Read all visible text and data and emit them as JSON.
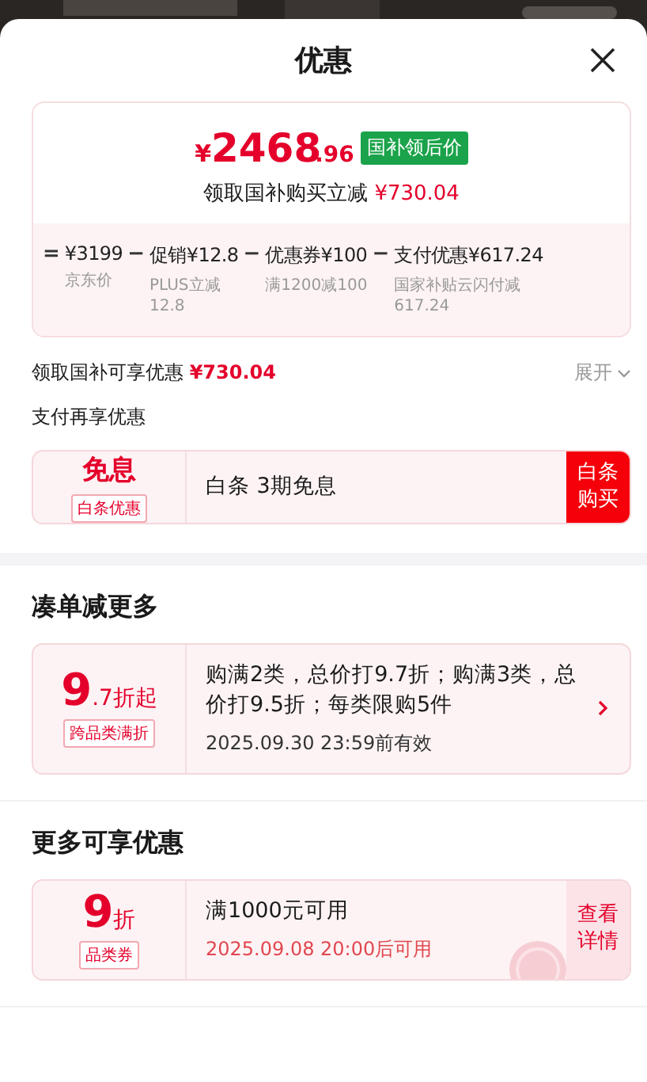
{
  "title": "优惠",
  "price_card": {
    "currency": "¥",
    "integer": "2468",
    "decimal": ".96",
    "badge": "国补领后价",
    "saving_label": "领取国补购买立减",
    "saving_amount": "¥730.04",
    "breakdown": [
      {
        "operator": "=",
        "label": "¥3199",
        "note": "京东价"
      },
      {
        "operator": "−",
        "label": "促销¥12.8",
        "note": "PLUS立减\n12.8"
      },
      {
        "operator": "−",
        "label": "优惠券¥100",
        "note": "满1200减100"
      },
      {
        "operator": "−",
        "label": "支付优惠¥617.24",
        "note": "国家补贴云闪付减\n617.24"
      }
    ]
  },
  "subsidy_row": {
    "label": "领取国补可享优惠",
    "amount": "¥730.04",
    "toggle": "展开"
  },
  "pay_section": {
    "title": "支付再享优惠",
    "coupons": [
      {
        "kind": "interest_free",
        "value": "免息",
        "tag": "白条优惠",
        "text": "白条 3期免息",
        "action": "白条购买"
      }
    ]
  },
  "sections": [
    {
      "title": "凑单减更多",
      "coupons": [
        {
          "kind": "bundle",
          "value": "9",
          "unit": ".7折起",
          "tag": "跨品类满折",
          "text": "购满2类，总价打9.7折；购满3类，总价打9.5折；每类限购5件",
          "date": "2025.09.30 23:59前有效"
        }
      ]
    },
    {
      "title": "更多可享优惠",
      "coupons": [
        {
          "kind": "coupon",
          "value": "9",
          "unit": "折",
          "tag": "品类券",
          "text": "满1000元可用",
          "date": "2025.09.08 20:00后可用",
          "action": "查看详情"
        }
      ]
    }
  ]
}
